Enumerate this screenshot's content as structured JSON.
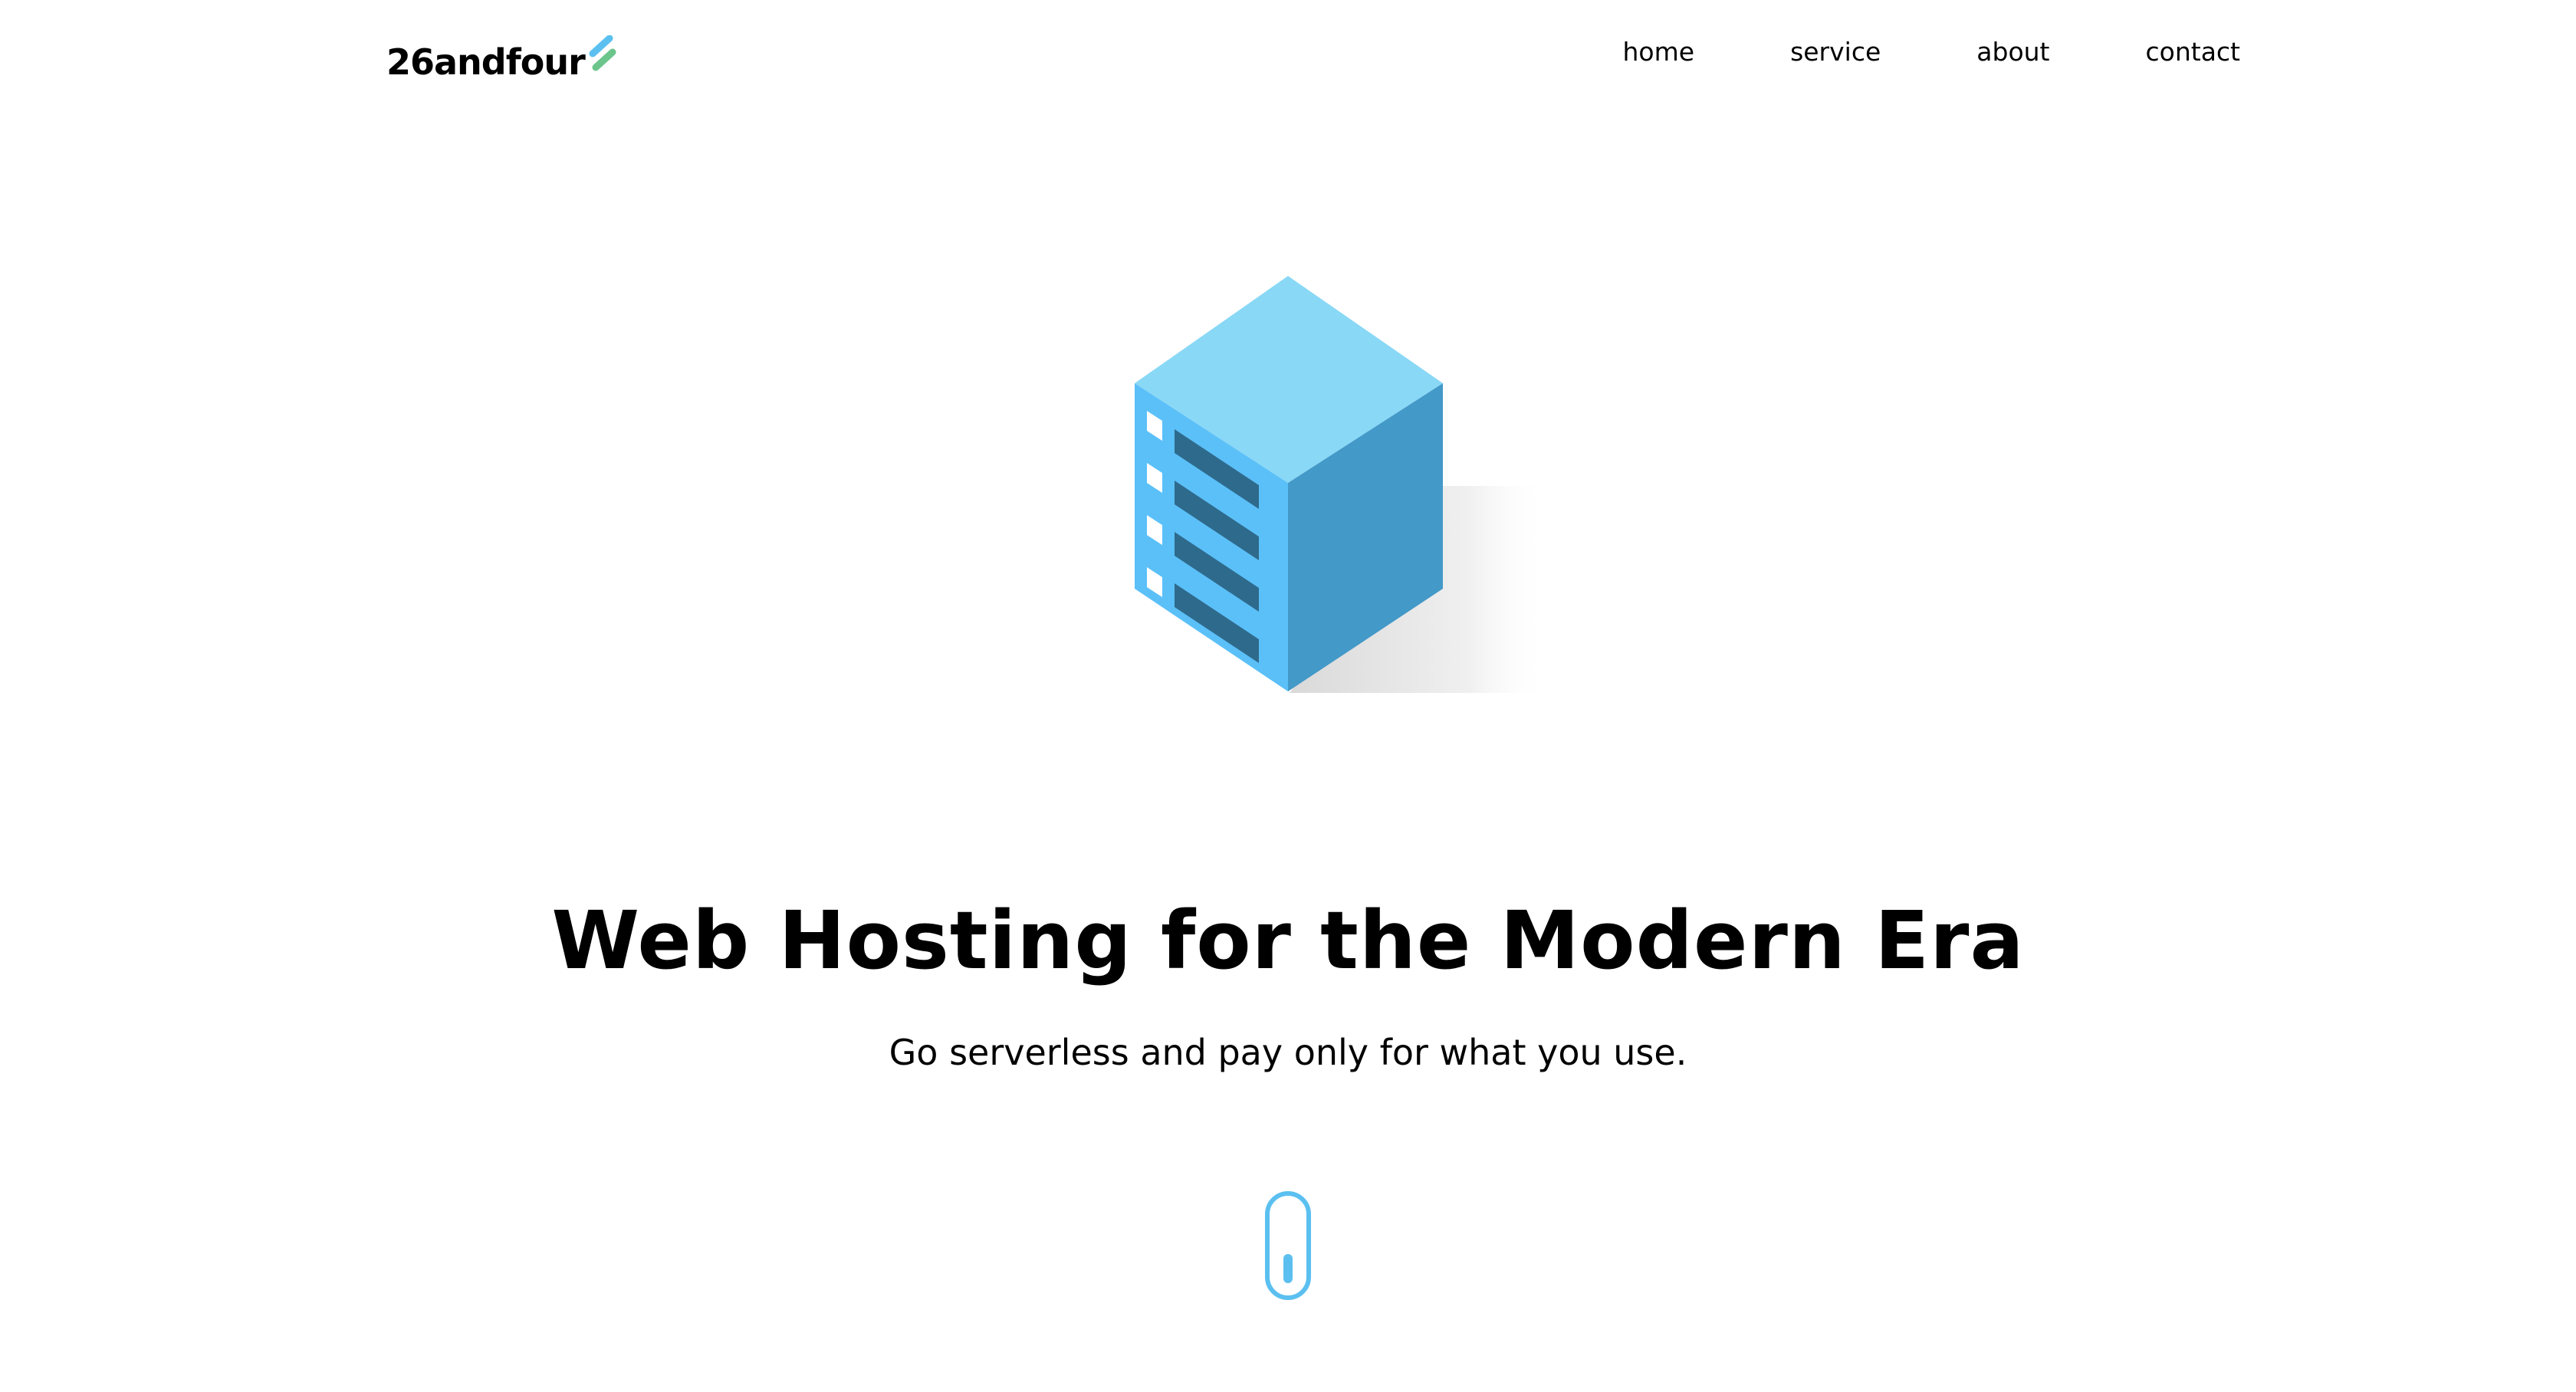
{
  "header": {
    "logo_text": "26andfour",
    "logo_mark_icon": "stripes-icon",
    "nav": [
      {
        "label": "home"
      },
      {
        "label": "service"
      },
      {
        "label": "about"
      },
      {
        "label": "contact"
      }
    ]
  },
  "hero": {
    "illustration_icon": "server-rack-icon",
    "title": "Web Hosting for the Modern Era",
    "subtitle": "Go serverless and pay only for what you use.",
    "scroll_icon": "mouse-scroll-icon"
  },
  "colors": {
    "accent_blue": "#5bc0f0",
    "accent_green": "#6cc58c",
    "cube_top": "#89d8f6",
    "cube_left": "#5bc0f8",
    "cube_right": "#4399c8",
    "slot_dark": "#2e6a8c"
  }
}
